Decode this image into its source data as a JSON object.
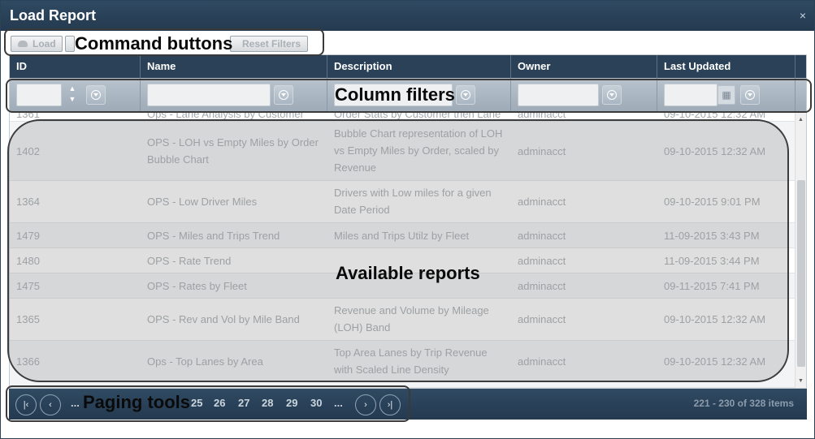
{
  "window": {
    "title": "Load Report",
    "close_glyph": "×"
  },
  "toolbar": {
    "load_label": "Load",
    "reset_label": "Reset Filters"
  },
  "columns": [
    "ID",
    "Name",
    "Description",
    "Owner",
    "Last Updated"
  ],
  "rows": [
    {
      "id": "1361",
      "name": "Ops - Lane Analysis by Customer",
      "description": "Order Stats by Customer then Lane",
      "owner": "adminacct",
      "updated": "09-10-2015 12:32 AM"
    },
    {
      "id": "1402",
      "name": "OPS - LOH vs Empty Miles by Order Bubble Chart",
      "description": "Bubble Chart representation of LOH vs Empty Miles by Order, scaled by Revenue",
      "owner": "adminacct",
      "updated": "09-10-2015 12:32 AM"
    },
    {
      "id": "1364",
      "name": "OPS - Low Driver Miles",
      "description": "Drivers with Low miles for a given Date Period",
      "owner": "adminacct",
      "updated": "09-10-2015 9:01 PM"
    },
    {
      "id": "1479",
      "name": "OPS - Miles and Trips Trend",
      "description": "Miles and Trips Utilz by Fleet",
      "owner": "adminacct",
      "updated": "11-09-2015 3:43 PM"
    },
    {
      "id": "1480",
      "name": "OPS - Rate Trend",
      "description": "",
      "owner": "adminacct",
      "updated": "11-09-2015 3:44 PM"
    },
    {
      "id": "1475",
      "name": "OPS - Rates by Fleet",
      "description": "",
      "owner": "adminacct",
      "updated": "09-11-2015 7:41 PM"
    },
    {
      "id": "1365",
      "name": "OPS - Rev and Vol by Mile Band",
      "description": "Revenue and Volume by Mileage (LOH) Band",
      "owner": "adminacct",
      "updated": "09-10-2015 12:32 AM"
    },
    {
      "id": "1366",
      "name": "Ops - Top Lanes by Area",
      "description": "Top Area Lanes by Trip Revenue with Scaled Line Density",
      "owner": "adminacct",
      "updated": "09-10-2015 12:32 AM"
    }
  ],
  "pager": {
    "first": "|‹",
    "prev": "‹",
    "ellipsis_left": "...",
    "pages": [
      "25",
      "26",
      "27",
      "28",
      "29",
      "30"
    ],
    "ellipsis_right": "...",
    "next": "›",
    "last": "›|",
    "info": "221 - 230 of 328 items"
  },
  "callouts": {
    "command": "Command buttons",
    "filters": "Column filters",
    "reports": "Available reports",
    "paging": "Paging tools"
  },
  "colors": {
    "titlebar": "#2a4157",
    "header": "#2a4157",
    "filter_bg": "#aab6c2"
  }
}
